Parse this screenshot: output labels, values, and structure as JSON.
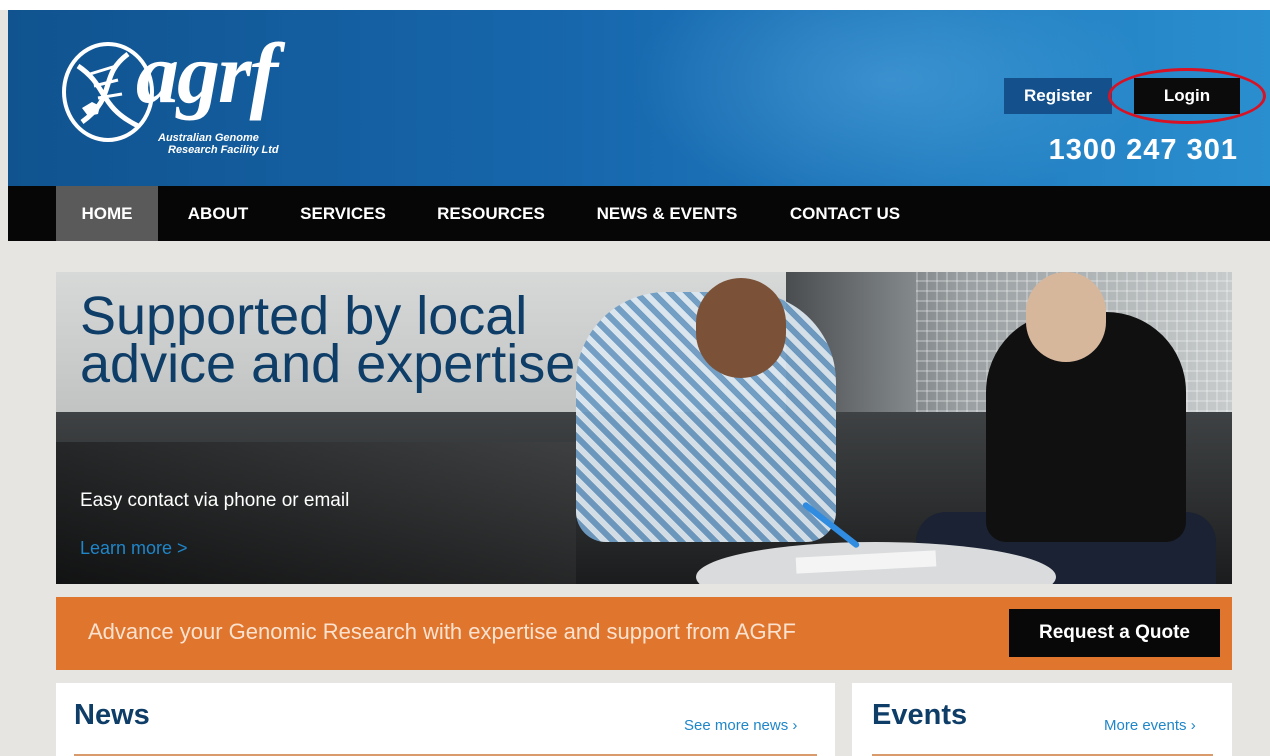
{
  "header": {
    "logo": {
      "wordmark": "agrf",
      "subtitle_line1": "Australian Genome",
      "subtitle_line2": "Research Facility Ltd"
    },
    "register_label": "Register",
    "login_label": "Login",
    "phone": "1300 247 301",
    "colors": {
      "header_blue": "#1767ad",
      "login_highlight": "#d81224"
    }
  },
  "nav": {
    "items": [
      {
        "label": "HOME",
        "active": true
      },
      {
        "label": "ABOUT"
      },
      {
        "label": "SERVICES"
      },
      {
        "label": "RESOURCES"
      },
      {
        "label": "NEWS & EVENTS"
      },
      {
        "label": "CONTACT US"
      }
    ]
  },
  "hero": {
    "headline_line1": "Supported by local",
    "headline_line2": "advice and expertise",
    "subtext": "Easy contact via phone or email",
    "link": "Learn more >"
  },
  "promo": {
    "text": "Advance your Genomic Research with expertise and support from AGRF",
    "button": "Request a Quote",
    "color": "#e0752e"
  },
  "news": {
    "title": "News",
    "more": "See more news ›"
  },
  "events": {
    "title": "Events",
    "more": "More events ›"
  }
}
